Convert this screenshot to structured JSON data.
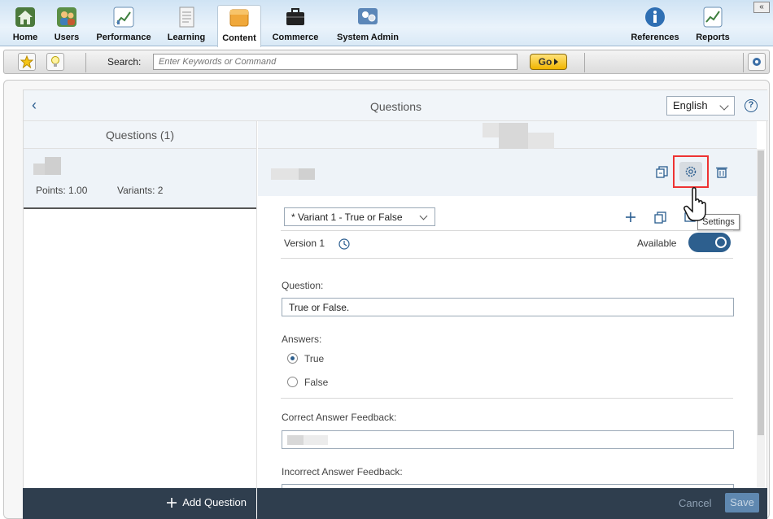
{
  "nav": {
    "items": [
      {
        "label": "Home",
        "icon": "home-icon"
      },
      {
        "label": "Users",
        "icon": "users-icon"
      },
      {
        "label": "Performance",
        "icon": "performance-icon"
      },
      {
        "label": "Learning",
        "icon": "learning-icon"
      },
      {
        "label": "Content",
        "icon": "content-icon",
        "active": true
      },
      {
        "label": "Commerce",
        "icon": "commerce-icon"
      },
      {
        "label": "System Admin",
        "icon": "system-admin-icon"
      },
      {
        "label": "References",
        "icon": "info-icon"
      },
      {
        "label": "Reports",
        "icon": "reports-icon"
      }
    ],
    "collapse_glyph": "«"
  },
  "searchbar": {
    "label": "Search:",
    "placeholder": "Enter Keywords or Command",
    "go_label": "Go"
  },
  "panel": {
    "title": "Questions",
    "language": "English",
    "help": "?"
  },
  "left": {
    "header": "Questions (1)",
    "item": {
      "points": "Points: 1.00",
      "variants": "Variants: 2"
    },
    "add_label": "Add Question"
  },
  "editor": {
    "variant_select": "* Variant 1 - True or False",
    "tooltip": "Settings",
    "version_label": "Version 1",
    "available_label": "Available",
    "available_on": true,
    "question_label": "Question:",
    "question_value": "True or False.",
    "answers_label": "Answers:",
    "answers": [
      {
        "label": "True",
        "selected": true
      },
      {
        "label": "False",
        "selected": false
      }
    ],
    "correct_feedback_label": "Correct Answer Feedback:",
    "incorrect_feedback_label": "Incorrect Answer Feedback:"
  },
  "footer": {
    "cancel_label": "Cancel",
    "save_label": "Save"
  },
  "colors": {
    "accent": "#2d5f8e",
    "footer": "#2f3e4e",
    "highlight": "#e33333",
    "go_button": "#f0b400"
  }
}
